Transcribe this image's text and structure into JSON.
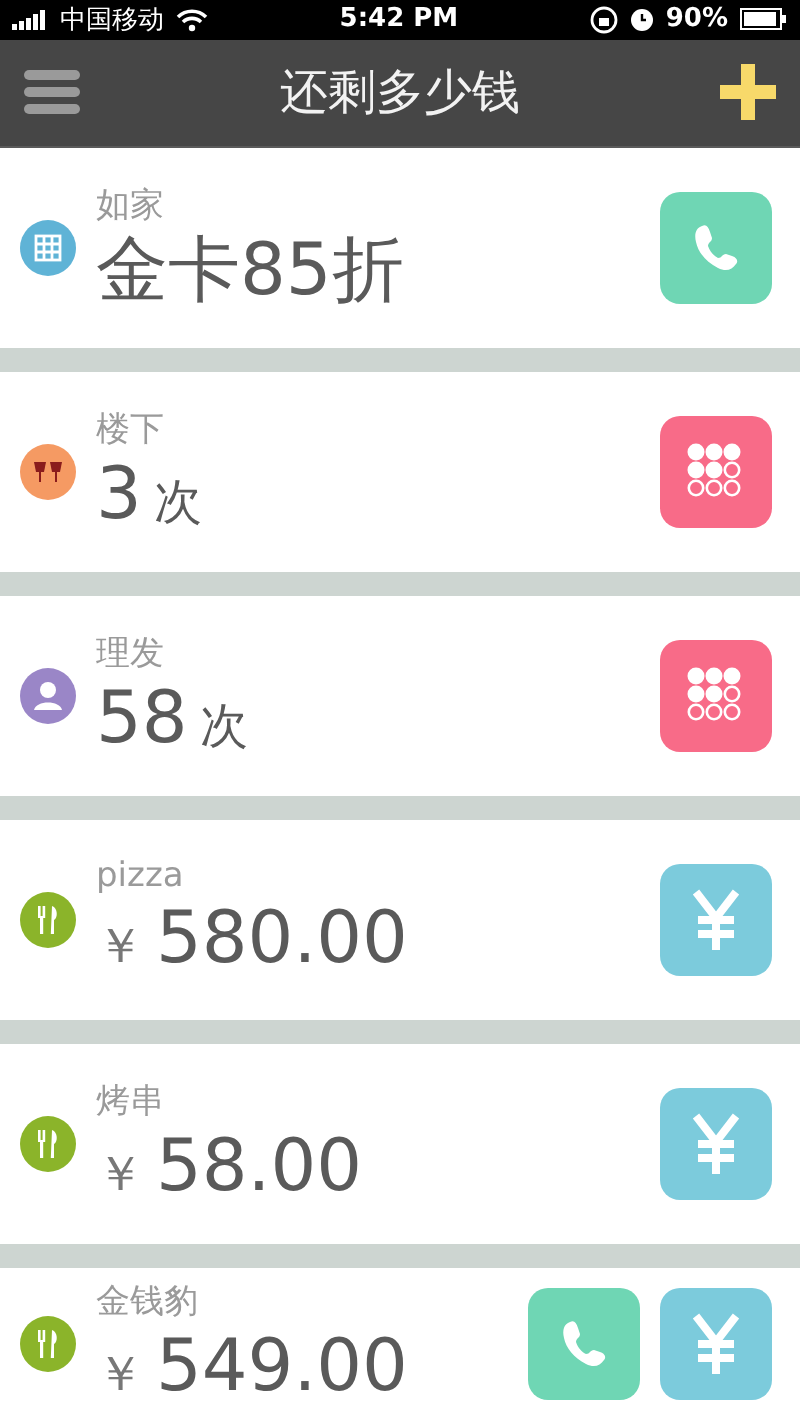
{
  "status_bar": {
    "carrier": "中国移动",
    "time": "5:42 PM",
    "battery": "90%"
  },
  "nav": {
    "title": "还剩多少钱"
  },
  "items": [
    {
      "label": "如家",
      "icon": {
        "kind": "building"
      },
      "value": "金卡85折",
      "actions": [
        {
          "kind": "phone"
        }
      ]
    },
    {
      "label": "楼下",
      "icon": {
        "kind": "cheers"
      },
      "amount": "3",
      "unit": "次",
      "actions": [
        {
          "kind": "punch"
        }
      ]
    },
    {
      "label": "理发",
      "icon": {
        "kind": "person"
      },
      "amount": "58",
      "unit": "次",
      "actions": [
        {
          "kind": "punch"
        }
      ]
    },
    {
      "label": "pizza",
      "icon": {
        "kind": "food"
      },
      "currency": "￥",
      "amount": "580.00",
      "actions": [
        {
          "kind": "money"
        }
      ]
    },
    {
      "label": "烤串",
      "icon": {
        "kind": "food"
      },
      "currency": "￥",
      "amount": "58.00",
      "actions": [
        {
          "kind": "money"
        }
      ]
    },
    {
      "label": "金钱豹",
      "icon": {
        "kind": "food"
      },
      "currency": "￥",
      "amount": "549.00",
      "actions": [
        {
          "kind": "phone"
        },
        {
          "kind": "money"
        }
      ]
    }
  ]
}
